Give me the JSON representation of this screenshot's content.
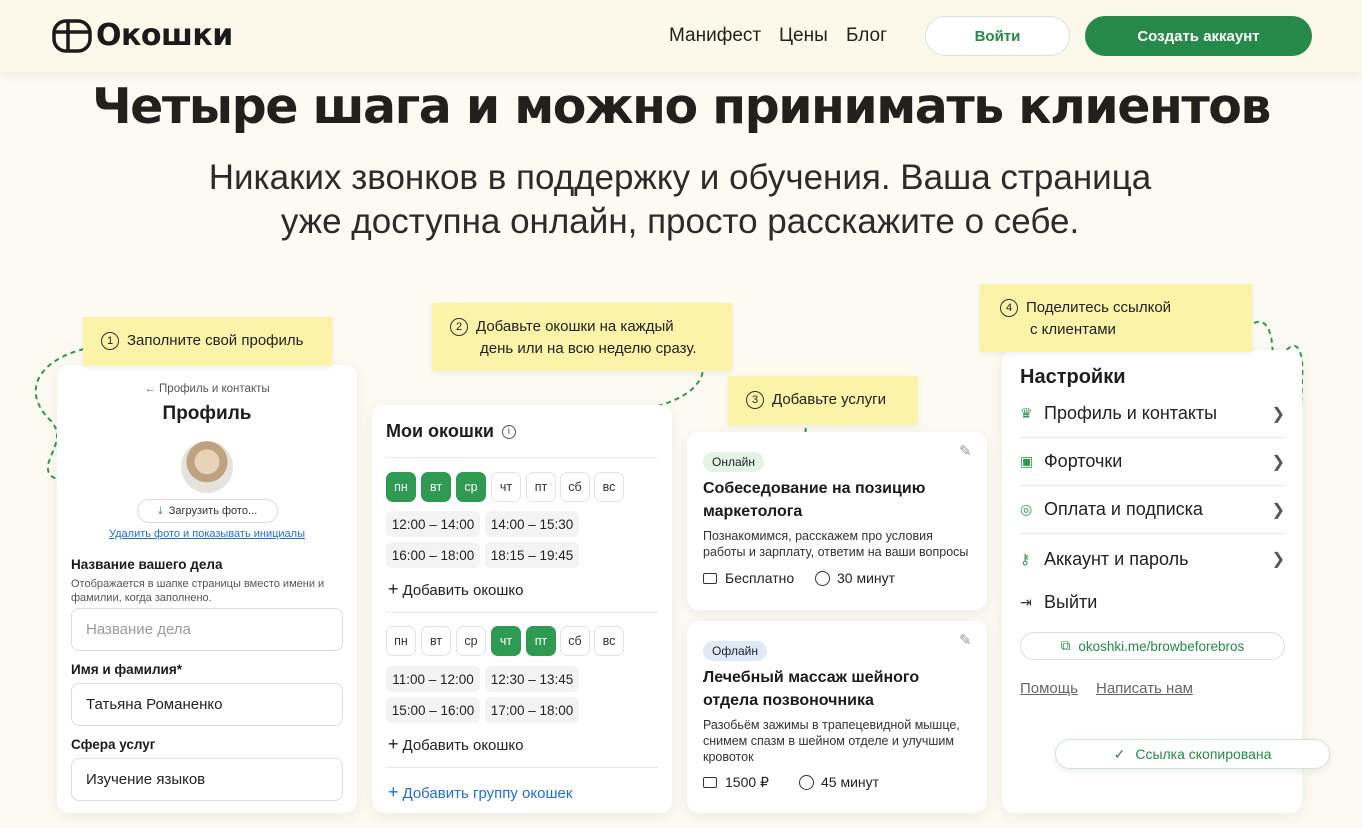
{
  "header": {
    "logo_text": "Окошки",
    "nav": [
      "Манифест",
      "Цены",
      "Блог"
    ],
    "login_label": "Войти",
    "signup_label": "Создать аккаунт"
  },
  "hero": {
    "title": "Четыре шага и можно принимать клиентов",
    "subtitle_line1": "Никаких звонков в поддержку и обучения. Ваша страница",
    "subtitle_line2": "уже доступна онлайн, просто расскажите о себе."
  },
  "steps": [
    {
      "num": "1",
      "text": "Заполните свой профиль"
    },
    {
      "num": "2",
      "line1": "Добавьте окошки на каждый",
      "line2": "день или на всю неделю сразу."
    },
    {
      "num": "3",
      "text": "Добавьте услуги"
    },
    {
      "num": "4",
      "line1": "Поделитесь ссылкой",
      "line2": "с клиентами"
    }
  ],
  "profile": {
    "back_link": "← Профиль и контакты",
    "title": "Профиль",
    "upload_label": "Загрузить фото...",
    "remove_link": "Удалить фото и показывать инициалы",
    "business_label": "Название вашего дела",
    "business_hint_line1": "Отображается в шапке страницы вместо имени и",
    "business_hint_line2": "фамилии, когда заполнено.",
    "business_placeholder": "Название дела",
    "name_label": "Имя и фамилия*",
    "name_value": "Татьяна Романенко",
    "sphere_label": "Сфера услуг",
    "sphere_value": "Изучение языков"
  },
  "windows": {
    "title": "Мои окошки",
    "info_icon": "info-icon",
    "group1": {
      "days": [
        {
          "label": "пн",
          "on": true
        },
        {
          "label": "вт",
          "on": true
        },
        {
          "label": "ср",
          "on": true
        },
        {
          "label": "чт",
          "on": false
        },
        {
          "label": "пт",
          "on": false
        },
        {
          "label": "сб",
          "on": false
        },
        {
          "label": "вс",
          "on": false
        }
      ],
      "slots": [
        "12:00 – 14:00",
        "14:00 – 15:30",
        "16:00 – 18:00",
        "18:15 – 19:45"
      ]
    },
    "group2": {
      "days": [
        {
          "label": "пн",
          "on": false
        },
        {
          "label": "вт",
          "on": false
        },
        {
          "label": "ср",
          "on": false
        },
        {
          "label": "чт",
          "on": true
        },
        {
          "label": "пт",
          "on": true
        },
        {
          "label": "сб",
          "on": false
        },
        {
          "label": "вс",
          "on": false
        }
      ],
      "slots": [
        "11:00 – 12:00",
        "12:30 – 13:45",
        "15:00 – 16:00",
        "17:00 – 18:00"
      ]
    },
    "add_window": "Добавить окошко",
    "add_group": "Добавить группу окошек"
  },
  "services": [
    {
      "badge": "Онлайн",
      "title_line1": "Собеседование на позицию",
      "title_line2": "маркетолога",
      "desc_line1": "Познакомимся, расскажем про условия",
      "desc_line2": "работы и зарплату, ответим на ваши вопросы",
      "price": "Бесплатно",
      "duration": "30 минут"
    },
    {
      "badge": "Офлайн",
      "title_line1": "Лечебный массаж шейного",
      "title_line2": "отдела позвоночника",
      "desc_line1": "Разобьём зажимы в трапецевидной мышце,",
      "desc_line2": "снимем спазм в шейном отделе и улучшим",
      "desc_line3": "кровоток",
      "price": "1500 ₽",
      "duration": "45 минут"
    }
  ],
  "settings": {
    "title": "Настройки",
    "items": [
      "Профиль и контакты",
      "Форточки",
      "Оплата и подписка",
      "Аккаунт и пароль"
    ],
    "logout": "Выйти",
    "link": "okoshki.me/browbeforebros",
    "help": "Помощь",
    "write": "Написать нам",
    "toast": "Ссылка скопирована"
  },
  "colors": {
    "accent": "#27894a",
    "sticky": "#fbf4a8",
    "background": "#fdfbf1"
  }
}
